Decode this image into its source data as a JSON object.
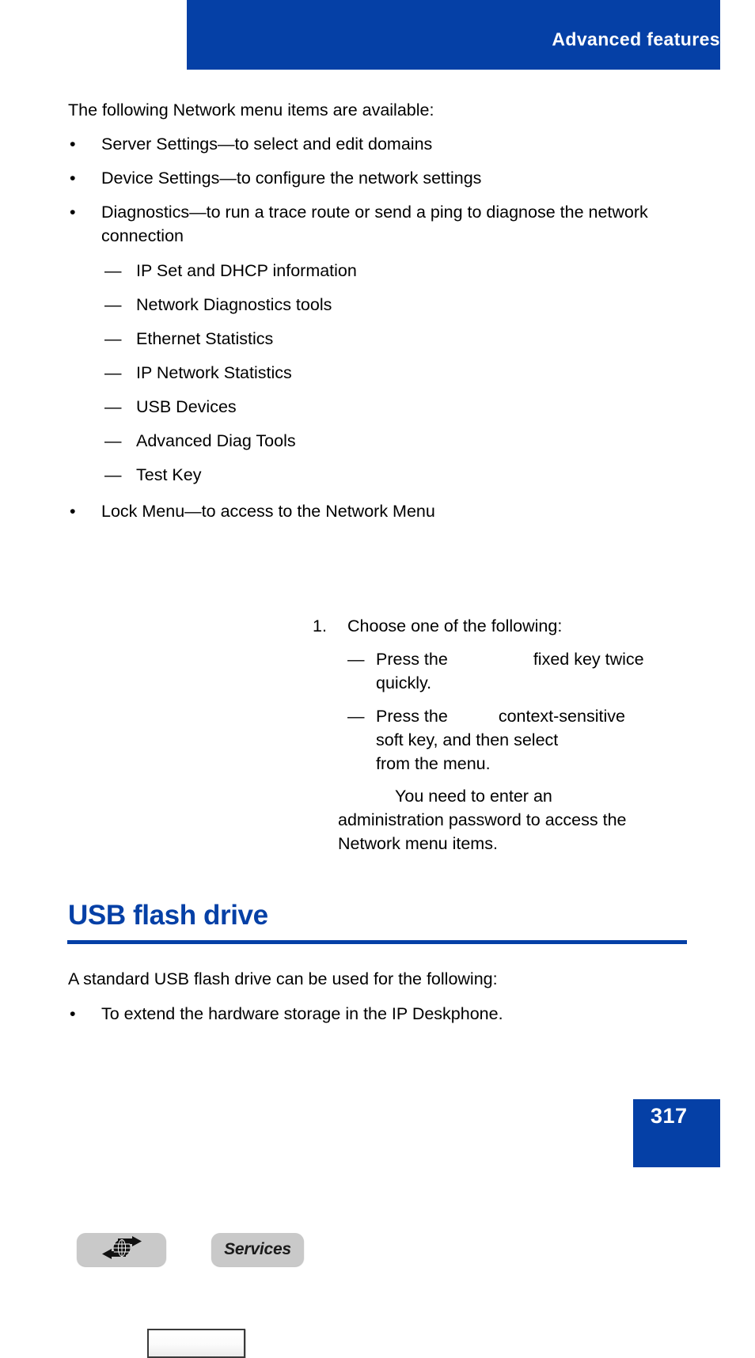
{
  "header": {
    "title": "Advanced features",
    "bar_color": "#0540a6"
  },
  "body": {
    "intro": "The following Network menu items are available:",
    "bullet_marker": "•",
    "dash_marker": "—",
    "network_menu_items": [
      "Server Settings—to select and edit domains",
      "Device Settings—to configure the network settings",
      "Diagnostics—to run a trace route or send a ping to diagnose the network connection"
    ],
    "diagnostics_sub_items": [
      "IP Set and DHCP information",
      "Network Diagnostics tools",
      "Ethernet Statistics",
      "IP Network Statistics",
      "USB Devices",
      "Advanced Diag Tools",
      "Test Key"
    ],
    "lock_menu_item": "Lock Menu—to access to the Network Menu"
  },
  "procedure": {
    "step_number": "1.",
    "step_text": "Choose one of the following:",
    "sub_steps": [
      {
        "marker": "—",
        "text_before": "Press the",
        "text_after": "fixed key twice",
        "text_line2": "quickly."
      },
      {
        "marker": "—",
        "text_before": "Press the",
        "text_after": "context-sensitive",
        "text_line2": "soft key, and then select",
        "text_line3": "from the menu."
      }
    ],
    "note": {
      "line1": "You need to enter an",
      "line2": "administration password to access the",
      "line3": "Network menu items."
    },
    "keys": [
      {
        "name": "services-globe-key",
        "icon": "globe-arrows-icon",
        "label": ""
      },
      {
        "name": "services-text-key",
        "icon": "",
        "label": "Services"
      },
      {
        "name": "blank-soft-key",
        "icon": "",
        "label": ""
      }
    ]
  },
  "usb_section": {
    "heading": "USB flash drive",
    "intro": "A standard USB flash drive can be used for the following:",
    "bullet_marker": "•",
    "items": [
      "To extend the hardware storage in the IP Deskphone."
    ]
  },
  "footer": {
    "page_number": "317",
    "block_color": "#0540a6"
  }
}
